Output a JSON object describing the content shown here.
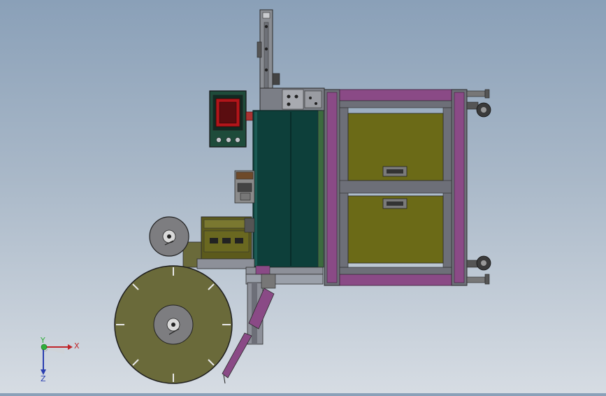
{
  "viewport": {
    "background_top": "#8aa0b8",
    "background_bottom": "#d6dce3"
  },
  "triad": {
    "x_label": "X",
    "y_label": "Y",
    "z_label": "Z",
    "x_color": "#c0262a",
    "y_color": "#2fae3a",
    "z_color": "#2a3fb0"
  },
  "colors": {
    "frame_steel": "#6d6f78",
    "frame_purple": "#8a4a86",
    "panel_olive": "#6b6a17",
    "cabinet_teal": "#0d3f3a",
    "reel_olive": "#6a6a3a",
    "hmi_red": "#b2151a"
  }
}
